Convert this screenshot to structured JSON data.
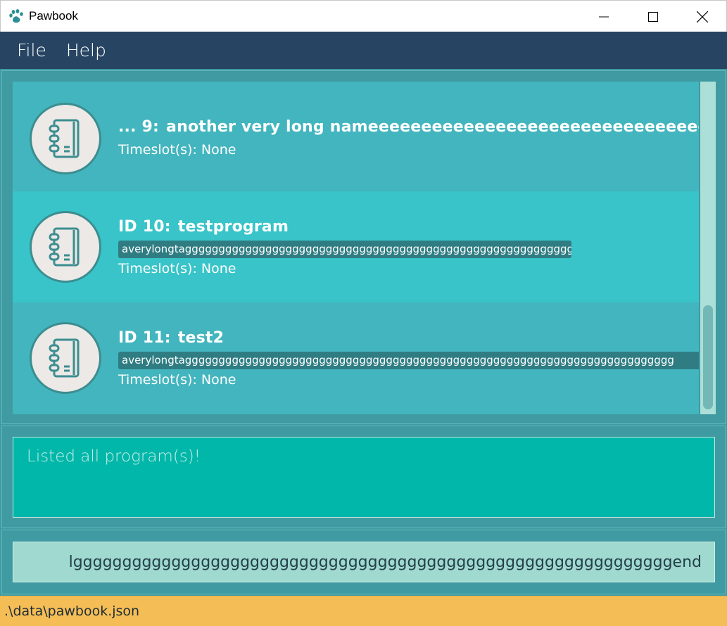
{
  "window": {
    "title": "Pawbook"
  },
  "menu": {
    "items": [
      "File",
      "Help"
    ]
  },
  "programs": [
    {
      "id_label": "... 9:",
      "name": "another very long nameeeeeeeeeeeeeeeeeeeeeeeeeeeeeeee...",
      "tag": "",
      "timeslots": "Timeslot(s): None"
    },
    {
      "id_label": "ID 10:",
      "name": "testprogram",
      "tag": "averylongtaggggggggggggggggggggggggggggggggggggggggggggggggggggggggggg",
      "timeslots": "Timeslot(s): None"
    },
    {
      "id_label": "ID 11:",
      "name": "test2",
      "tag": "averylongtaggggggggggggggggggggggggggggggggggggggggggggggggggggggggggggggggggggggggg",
      "timeslots": "Timeslot(s): None"
    }
  ],
  "result": {
    "message": "Listed all program(s)!"
  },
  "command": {
    "value": "lgggggggggggggggggggggggggggggggggggggggggggggggggggggggggggggend"
  },
  "status": {
    "file_path": ".\\data\\pawbook.json"
  },
  "colors": {
    "menu_bar": "#274563",
    "panel": "#3f9ba1",
    "card_odd": "#43b5be",
    "card_even": "#38c4c9",
    "result_box": "#00b7a9",
    "command_box": "#9fd9cf",
    "status_bar": "#f5bd55"
  }
}
